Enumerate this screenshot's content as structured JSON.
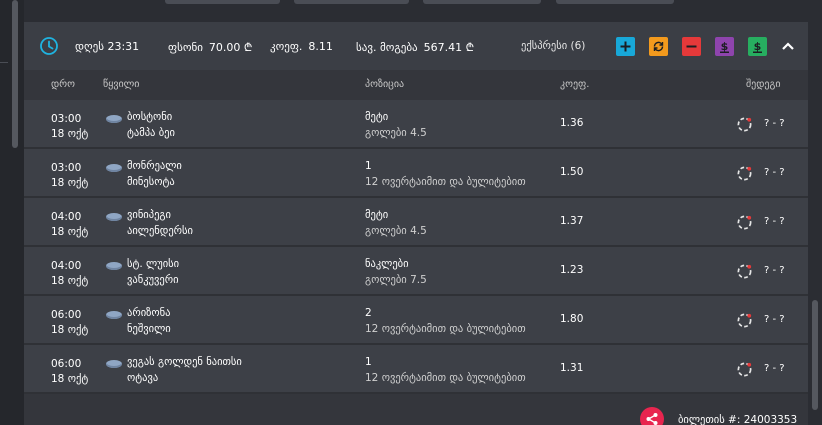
{
  "summary": {
    "date_label": "დღეს 23:31",
    "stake_label": "ფსონი",
    "stake_value": "70.00 ₾",
    "odds_label": "კოეფ.",
    "odds_value": "8.11",
    "win_label": "სავ. მოგება",
    "win_value": "567.41 ₾",
    "type_label": "ექსპრესი (6)"
  },
  "actions": [
    {
      "name": "add",
      "color": "#18a8d8",
      "icon": "plus-icon"
    },
    {
      "name": "refresh",
      "color": "#f39a1d",
      "icon": "refresh-icon"
    },
    {
      "name": "remove",
      "color": "#e5393a",
      "icon": "minus-icon"
    },
    {
      "name": "cashout-partial",
      "color": "#8e44ad",
      "icon": "dollar-icon"
    },
    {
      "name": "cashout",
      "color": "#27ae60",
      "icon": "dollar-icon"
    }
  ],
  "headers": {
    "time": "დრო",
    "event": "წყვილი",
    "position": "პოზიცია",
    "odds": "კოეფ.",
    "result": "შედეგი"
  },
  "rows": [
    {
      "time": "03:00",
      "date": "18 ოქტ",
      "team1": "ბოსტონი",
      "team2": "ტამპა ბეი",
      "pick": "მეტი",
      "market": "გოლები 4.5",
      "odds": "1.36",
      "score": "? - ?"
    },
    {
      "time": "03:00",
      "date": "18 ოქტ",
      "team1": "მონრეალი",
      "team2": "მინესოტა",
      "pick": "1",
      "market": "12 ოვერტაიმით და ბულიტებით",
      "odds": "1.50",
      "score": "? - ?"
    },
    {
      "time": "04:00",
      "date": "18 ოქტ",
      "team1": "ვინიპეგი",
      "team2": "აილენდერსი",
      "pick": "მეტი",
      "market": "გოლები 4.5",
      "odds": "1.37",
      "score": "? - ?"
    },
    {
      "time": "04:00",
      "date": "18 ოქტ",
      "team1": "სტ. ლუისი",
      "team2": "ვანკუვერი",
      "pick": "ნაკლები",
      "market": "გოლები 7.5",
      "odds": "1.23",
      "score": "? - ?"
    },
    {
      "time": "06:00",
      "date": "18 ოქტ",
      "team1": "არიზონა",
      "team2": "ნეშვილი",
      "pick": "2",
      "market": "12 ოვერტაიმით და ბულიტებით",
      "odds": "1.80",
      "score": "? - ?"
    },
    {
      "time": "06:00",
      "date": "18 ოქტ",
      "team1": "ვეგას გოლდენ ნაითსი",
      "team2": "ოტავა",
      "pick": "1",
      "market": "12 ოვერტაიმით და ბულიტებით",
      "odds": "1.31",
      "score": "? - ?"
    }
  ],
  "footer": {
    "ticket_text": "ბილეთის #: 24003353"
  }
}
